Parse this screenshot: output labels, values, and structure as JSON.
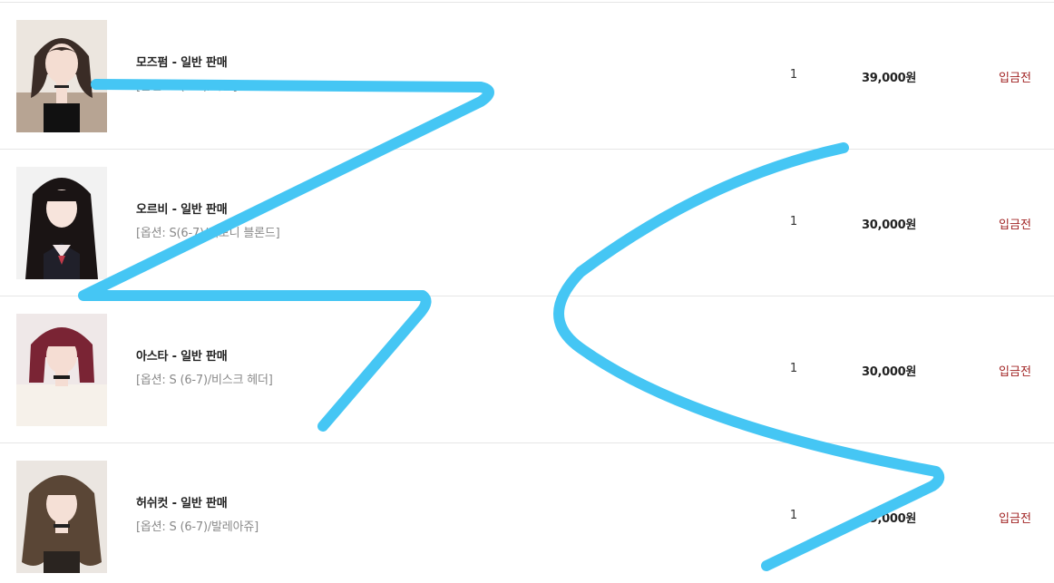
{
  "accent_colors": {
    "status": "#a12424",
    "scribble": "#45c6f4"
  },
  "orders": [
    {
      "thumb_icon": "doll-product-image",
      "name": "모즈펌 - 일반 판매",
      "option": "[옵션: S (6-7)/아론]",
      "qty": "1",
      "price": "39,000원",
      "status": "입금전"
    },
    {
      "thumb_icon": "doll-product-image",
      "name": "오르비 - 일반 판매",
      "option": "[옵션: S(6-7)/에보니 블론드]",
      "qty": "1",
      "price": "30,000원",
      "status": "입금전"
    },
    {
      "thumb_icon": "doll-product-image",
      "name": "아스타 - 일반 판매",
      "option": "[옵션: S (6-7)/비스크 헤더]",
      "qty": "1",
      "price": "30,000원",
      "status": "입금전"
    },
    {
      "thumb_icon": "doll-product-image",
      "name": "허쉬컷 - 일반 판매",
      "option": "[옵션: S (6-7)/발레아쥬]",
      "qty": "1",
      "price": "39,000원",
      "status": "입금전"
    }
  ]
}
